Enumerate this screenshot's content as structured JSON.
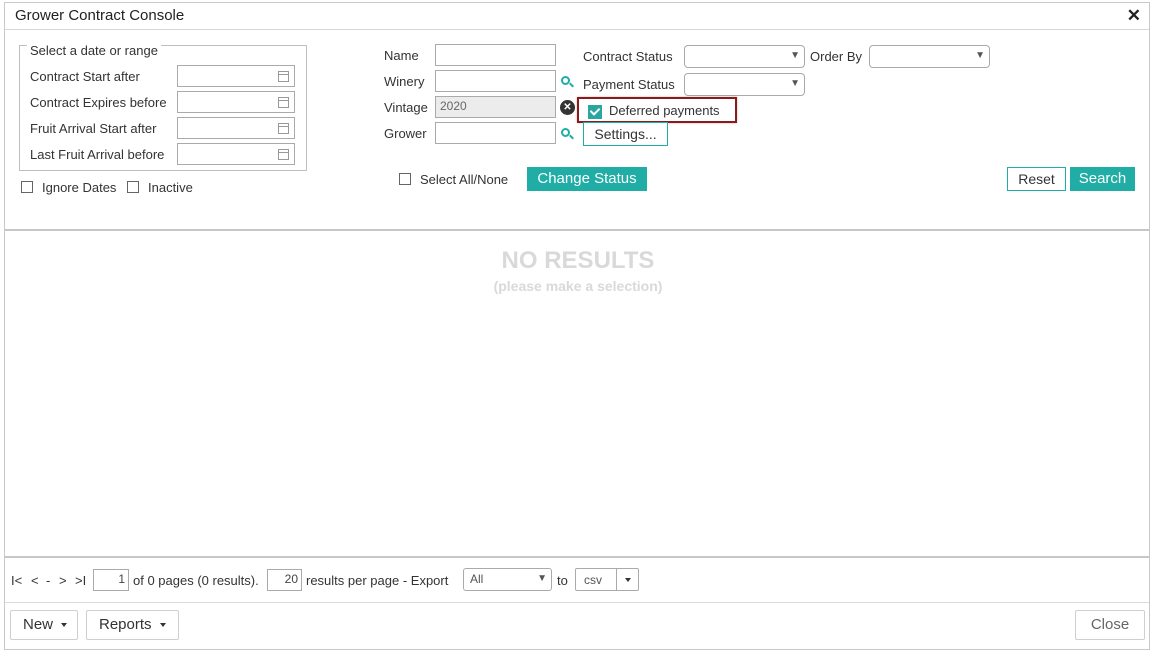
{
  "window": {
    "title": "Grower Contract Console",
    "close_glyph": "✕"
  },
  "date_range": {
    "legend": "Select a date or range",
    "fields": [
      {
        "label": "Contract Start after"
      },
      {
        "label": "Contract Expires before"
      },
      {
        "label": "Fruit Arrival Start after"
      },
      {
        "label": "Last Fruit Arrival before"
      }
    ],
    "ignore_dates_label": "Ignore Dates",
    "inactive_label": "Inactive"
  },
  "filters": {
    "name_label": "Name",
    "winery_label": "Winery",
    "vintage_label": "Vintage",
    "vintage_value": "2020",
    "grower_label": "Grower",
    "contract_status_label": "Contract Status",
    "order_by_label": "Order By",
    "payment_status_label": "Payment Status",
    "deferred_payments_label": "Deferred payments",
    "settings_label": "Settings..."
  },
  "actions": {
    "select_all_label": "Select All/None",
    "change_status_label": "Change Status",
    "reset_label": "Reset",
    "search_label": "Search"
  },
  "results": {
    "empty_title": "NO RESULTS",
    "empty_subtitle": "(please make a selection)"
  },
  "pager": {
    "first": "I<",
    "prev": "<",
    "dash": "-",
    "next": ">",
    "last": ">I",
    "page_value": "1",
    "of_text": "of 0 pages (0 results).",
    "per_page_value": "20",
    "per_page_text": "results per page - Export",
    "export_scope": "All",
    "to_text": "to",
    "format": "csv"
  },
  "footer": {
    "new_label": "New",
    "reports_label": "Reports",
    "close_label": "Close"
  },
  "colors": {
    "accent": "#1fada5",
    "highlight_border": "#8b1a1a"
  }
}
